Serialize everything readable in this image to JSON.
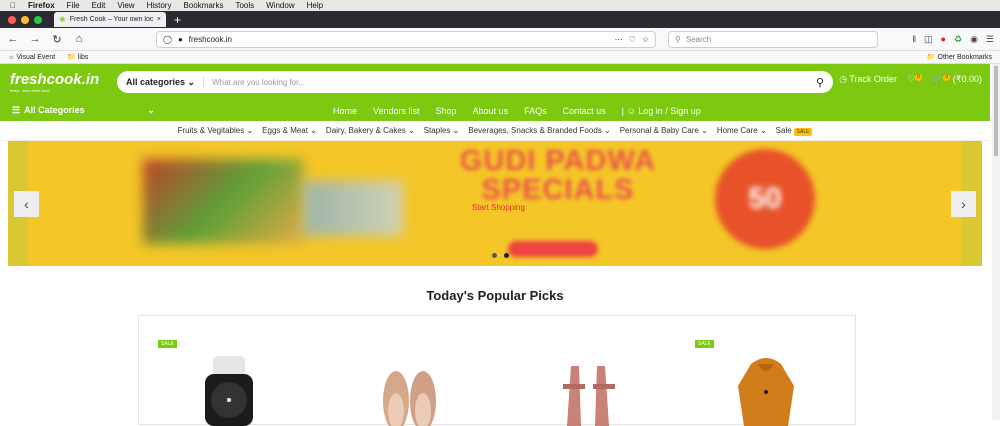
{
  "mac": {
    "app": "Firefox",
    "menus": [
      "File",
      "Edit",
      "View",
      "History",
      "Bookmarks",
      "Tools",
      "Window",
      "Help"
    ]
  },
  "tab": {
    "title": "Fresh Cook – Your own local st"
  },
  "browser": {
    "url": "freshcook.in",
    "search_placeholder": "Search"
  },
  "bookmarks": {
    "items": [
      "Visual Event",
      "libs"
    ],
    "other": "Other Bookmarks"
  },
  "site": {
    "logo": "freshcook.in",
    "tagline": "fresh · farm fresh food",
    "search": {
      "category": "All categories",
      "placeholder": "What are you looking for..."
    },
    "track": "Track Order",
    "wish_count": "0",
    "cart_count": "0",
    "cart_total": "(₹0.00)",
    "all_categories": "All Categories",
    "menu": [
      "Home",
      "Vendors list",
      "Shop",
      "About us",
      "FAQs",
      "Contact us"
    ],
    "login": "Log in / Sign up",
    "catnav": [
      "Fruits & Vegitables",
      "Eggs & Meat",
      "Dairy, Bakery & Cakes",
      "Staples",
      "Beverages, Snacks & Branded Foods",
      "Personal & Baby Care",
      "Home Care",
      "Sale"
    ],
    "sale_tag": "SALE",
    "banner": {
      "title": "GUDI PADWA SPECIALS",
      "cta": "Start Shopping",
      "discount": "50"
    },
    "popular": "Today's Popular Picks",
    "products": [
      {
        "sale": "SALE"
      },
      {
        "sale": ""
      },
      {
        "sale": ""
      },
      {
        "sale": "SALE"
      }
    ]
  },
  "colors": {
    "brand": "#7dc810",
    "banner": "#f4c628"
  }
}
